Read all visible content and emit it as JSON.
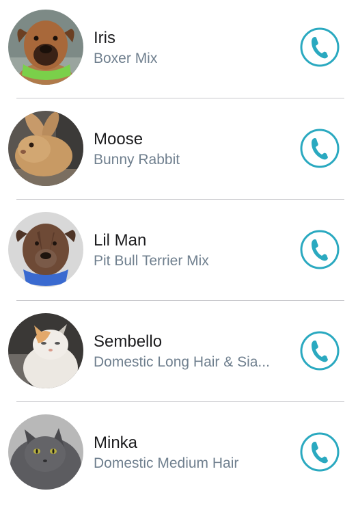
{
  "accent_color": "#2aa9c0",
  "pets": [
    {
      "name": "Iris",
      "breed": "Boxer Mix",
      "photo": "boxer-dog-photo",
      "action_icon": "phone-icon"
    },
    {
      "name": "Moose",
      "breed": "Bunny Rabbit",
      "photo": "rabbit-photo",
      "action_icon": "phone-icon"
    },
    {
      "name": "Lil Man",
      "breed": "Pit Bull Terrier Mix",
      "photo": "pit-bull-dog-photo",
      "action_icon": "phone-icon"
    },
    {
      "name": "Sembello",
      "breed": "Domestic Long Hair & Sia...",
      "photo": "long-hair-cat-photo",
      "action_icon": "phone-icon"
    },
    {
      "name": "Minka",
      "breed": "Domestic Medium Hair",
      "photo": "gray-cat-photo",
      "action_icon": "phone-icon"
    }
  ]
}
